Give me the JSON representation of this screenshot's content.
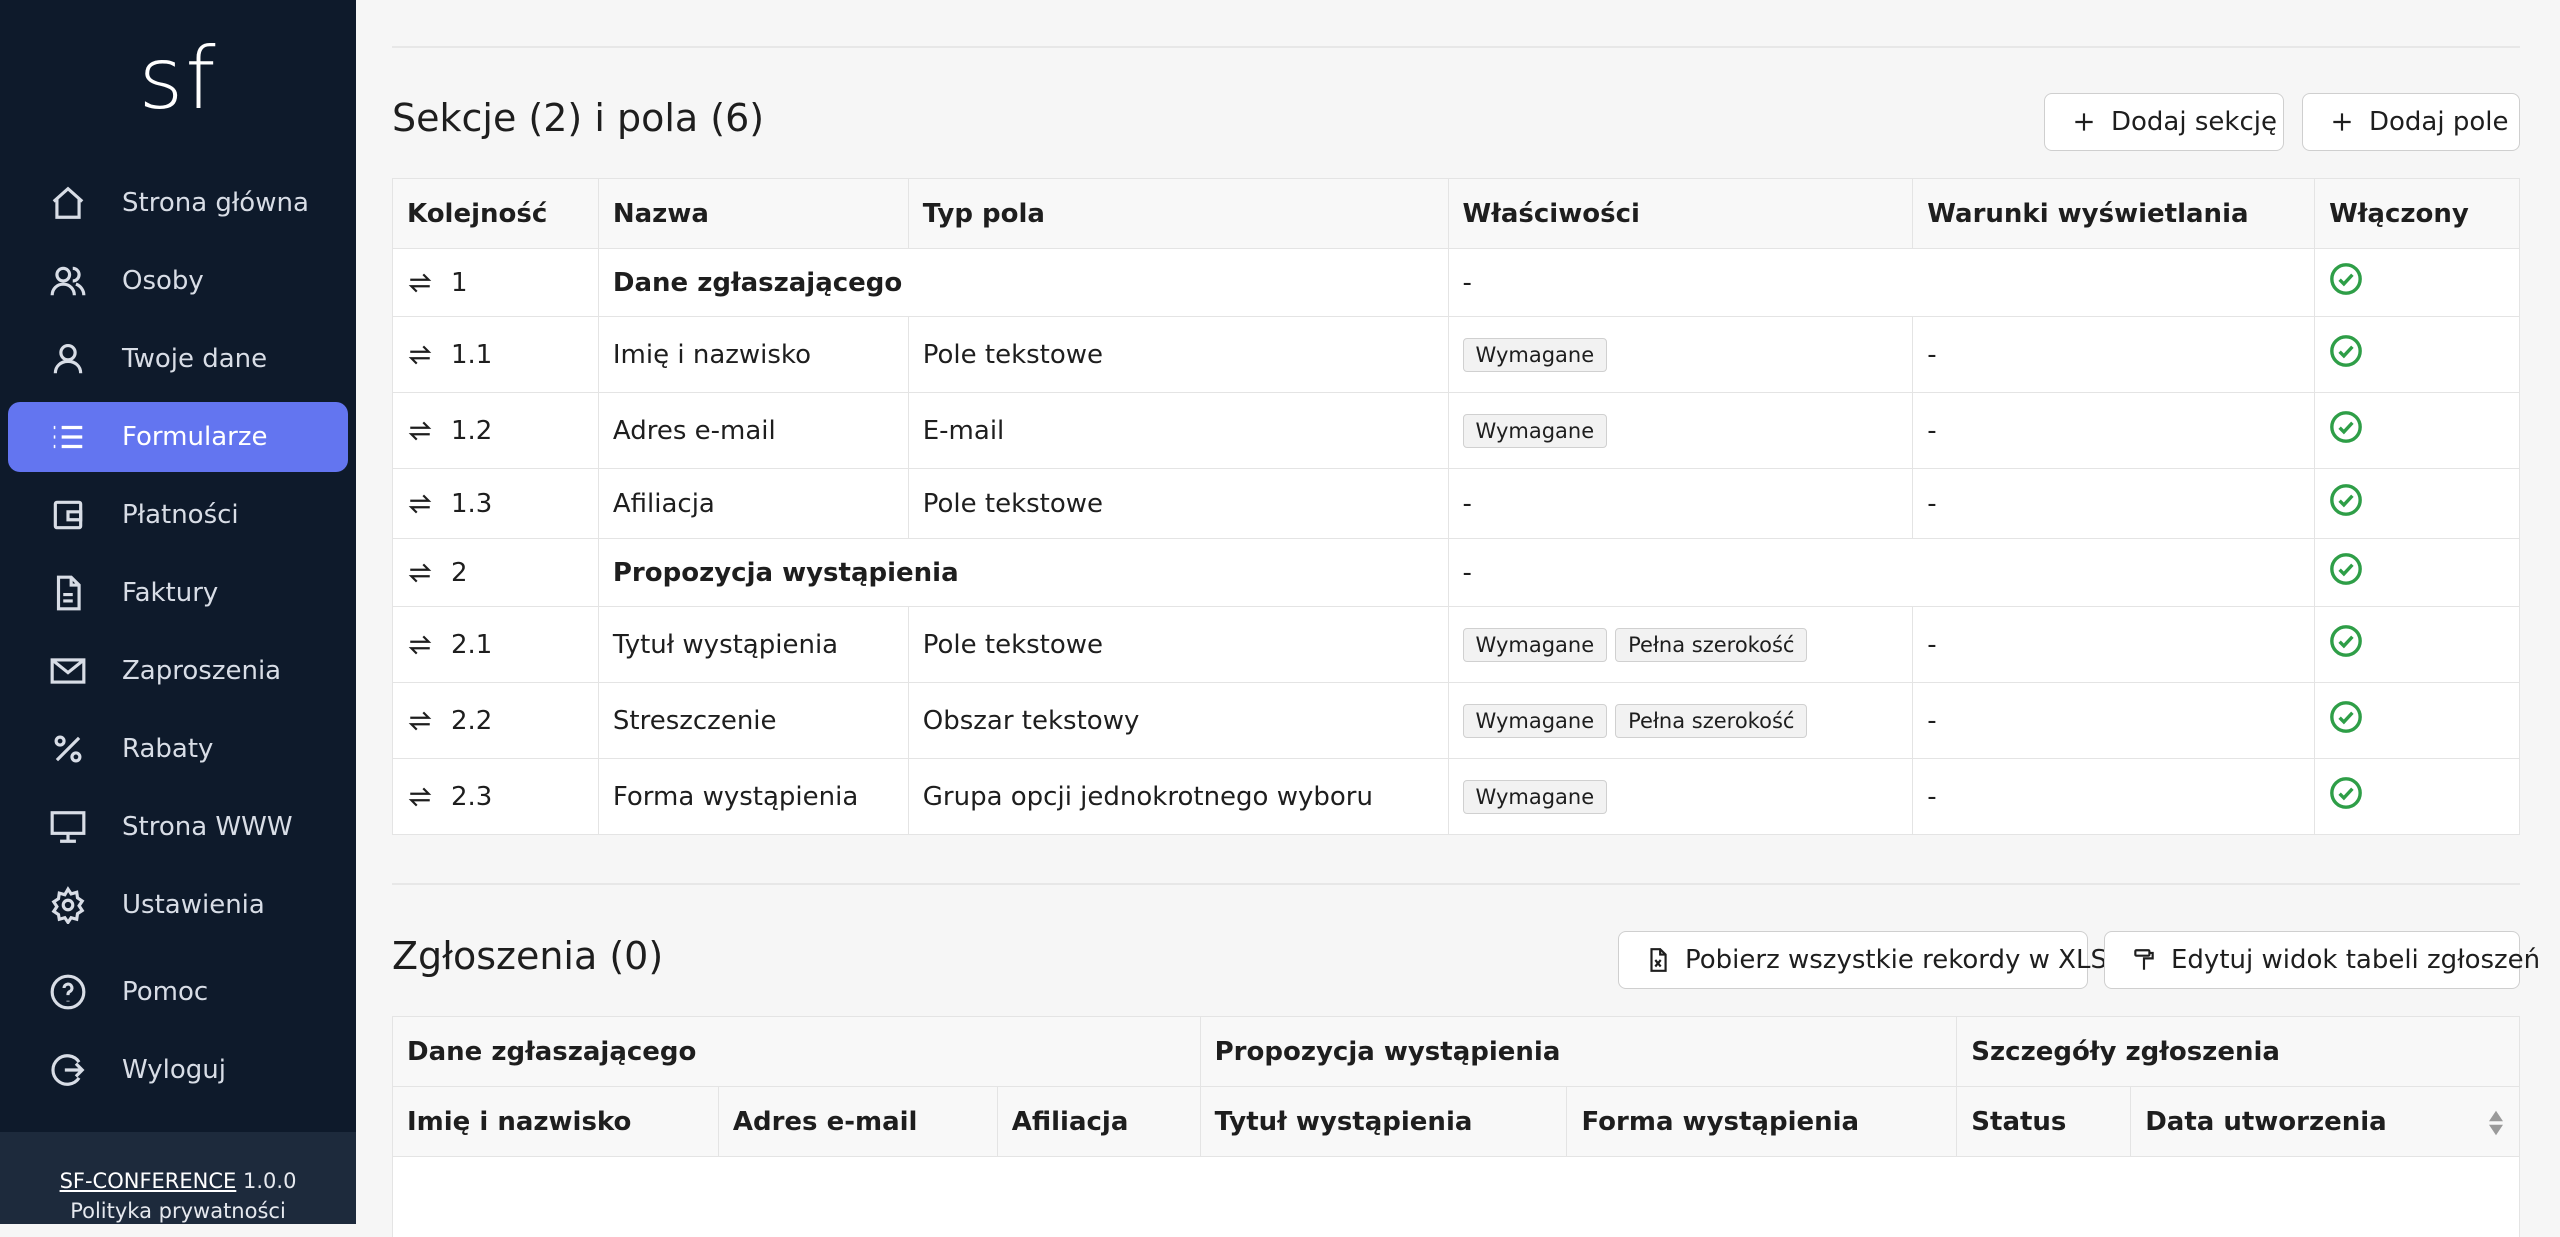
{
  "sidebar": {
    "logo": "sf",
    "items": [
      {
        "label": "Strona główna",
        "icon": "home-icon"
      },
      {
        "label": "Osoby",
        "icon": "users-icon"
      },
      {
        "label": "Twoje dane",
        "icon": "user-icon"
      },
      {
        "label": "Formularze",
        "icon": "list-icon",
        "active": true
      },
      {
        "label": "Płatności",
        "icon": "wallet-icon"
      },
      {
        "label": "Faktury",
        "icon": "document-icon"
      },
      {
        "label": "Zaproszenia",
        "icon": "mail-icon"
      },
      {
        "label": "Rabaty",
        "icon": "percent-icon"
      },
      {
        "label": "Strona WWW",
        "icon": "monitor-icon"
      },
      {
        "label": "Ustawienia",
        "icon": "gear-icon"
      },
      {
        "label": "Pomoc",
        "icon": "help-icon"
      },
      {
        "label": "Wyloguj",
        "icon": "logout-icon"
      }
    ],
    "footer": {
      "brand": "SF-CONFERENCE",
      "version": "1.0.0",
      "privacy": "Polityka prywatności"
    }
  },
  "fields_section": {
    "title": "Sekcje (2) i pola (6)",
    "add_section_label": "Dodaj sekcję",
    "add_field_label": "Dodaj pole",
    "columns": [
      "Kolejność",
      "Nazwa",
      "Typ pola",
      "Właściwości",
      "Warunki wyświetlania",
      "Włączony"
    ],
    "rows": [
      {
        "order": "1",
        "name": "Dane zgłaszającego",
        "type": "",
        "props": [],
        "props_text": "-",
        "conditions": "",
        "section": true,
        "enabled": true
      },
      {
        "order": "1.1",
        "name": "Imię i nazwisko",
        "type": "Pole tekstowe",
        "props": [
          "Wymagane"
        ],
        "props_text": "",
        "conditions": "-",
        "section": false,
        "enabled": true
      },
      {
        "order": "1.2",
        "name": "Adres e-mail",
        "type": "E-mail",
        "props": [
          "Wymagane"
        ],
        "props_text": "",
        "conditions": "-",
        "section": false,
        "enabled": true
      },
      {
        "order": "1.3",
        "name": "Afiliacja",
        "type": "Pole tekstowe",
        "props": [],
        "props_text": "-",
        "conditions": "-",
        "section": false,
        "enabled": true
      },
      {
        "order": "2",
        "name": "Propozycja wystąpienia",
        "type": "",
        "props": [],
        "props_text": "-",
        "conditions": "",
        "section": true,
        "enabled": true
      },
      {
        "order": "2.1",
        "name": "Tytuł wystąpienia",
        "type": "Pole tekstowe",
        "props": [
          "Wymagane",
          "Pełna szerokość"
        ],
        "props_text": "",
        "conditions": "-",
        "section": false,
        "enabled": true
      },
      {
        "order": "2.2",
        "name": "Streszczenie",
        "type": "Obszar tekstowy",
        "props": [
          "Wymagane",
          "Pełna szerokość"
        ],
        "props_text": "",
        "conditions": "-",
        "section": false,
        "enabled": true
      },
      {
        "order": "2.3",
        "name": "Forma wystąpienia",
        "type": "Grupa opcji jednokrotnego wyboru",
        "props": [
          "Wymagane"
        ],
        "props_text": "",
        "conditions": "-",
        "section": false,
        "enabled": true
      }
    ]
  },
  "submissions_section": {
    "title": "Zgłoszenia (0)",
    "download_label": "Pobierz wszystkie rekordy w XLS",
    "edit_view_label": "Edytuj widok tabeli zgłoszeń",
    "group_headers": [
      "Dane zgłaszającego",
      "Propozycja wystąpienia",
      "Szczegóły zgłoszenia"
    ],
    "columns": [
      "Imię i nazwisko",
      "Adres e-mail",
      "Afiliacja",
      "Tytuł wystąpienia",
      "Forma wystąpienia",
      "Status",
      "Data utworzenia"
    ]
  },
  "colors": {
    "sidebar_bg": "#0e1a2b",
    "active_bg": "#6375f0",
    "check_color": "#2e9e47"
  }
}
